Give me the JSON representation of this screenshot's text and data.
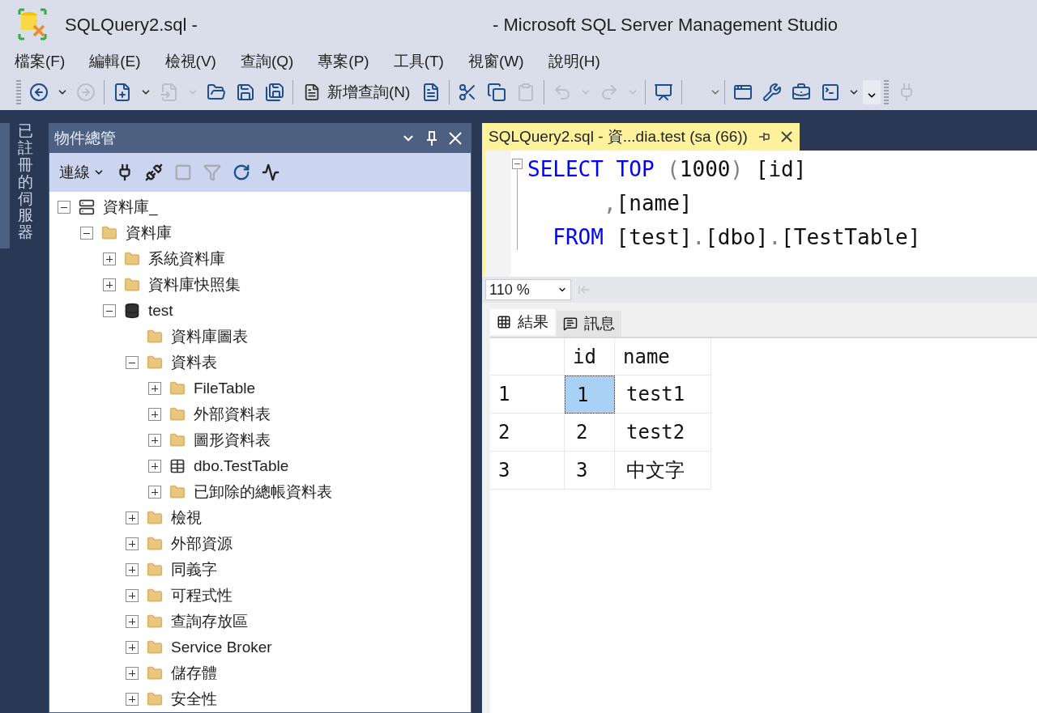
{
  "window": {
    "title_left": "SQLQuery2.sql -",
    "title_right": "- Microsoft SQL Server Management Studio"
  },
  "menu": [
    "檔案(F)",
    "編輯(E)",
    "檢視(V)",
    "查詢(Q)",
    "專案(P)",
    "工具(T)",
    "視窗(W)",
    "說明(H)"
  ],
  "toolbar": [
    {
      "kind": "grip"
    },
    {
      "kind": "icon",
      "disabled": false
    },
    {
      "kind": "caret",
      "disabled": false
    },
    {
      "kind": "icon",
      "disabled": true
    },
    {
      "kind": "sep"
    },
    {
      "kind": "icon",
      "disabled": false
    },
    {
      "kind": "caret",
      "disabled": false
    },
    {
      "kind": "icon",
      "disabled": true
    },
    {
      "kind": "caret",
      "disabled": true
    },
    {
      "kind": "icon",
      "disabled": false
    },
    {
      "kind": "icon",
      "disabled": false
    },
    {
      "kind": "icon",
      "disabled": false
    },
    {
      "kind": "sep"
    },
    {
      "kind": "labeled",
      "label": "新增查詢(N)",
      "disabled": false
    },
    {
      "kind": "icon",
      "disabled": false
    },
    {
      "kind": "sep"
    },
    {
      "kind": "icon",
      "disabled": false
    },
    {
      "kind": "icon",
      "disabled": false
    },
    {
      "kind": "icon",
      "disabled": true
    },
    {
      "kind": "sep"
    },
    {
      "kind": "icon",
      "disabled": true
    },
    {
      "kind": "caret",
      "disabled": true
    },
    {
      "kind": "icon",
      "disabled": true
    },
    {
      "kind": "caret",
      "disabled": true
    },
    {
      "kind": "sep"
    },
    {
      "kind": "icon",
      "disabled": false
    },
    {
      "kind": "sep"
    },
    {
      "kind": "combo",
      "disabled": false
    },
    {
      "kind": "sep"
    },
    {
      "kind": "icon",
      "disabled": false
    },
    {
      "kind": "icon",
      "disabled": false
    },
    {
      "kind": "icon",
      "disabled": false
    },
    {
      "kind": "icon",
      "disabled": false
    },
    {
      "kind": "caret",
      "disabled": false
    },
    {
      "kind": "overflow"
    },
    {
      "kind": "grip"
    },
    {
      "kind": "icon",
      "disabled": true
    }
  ],
  "side_strip": {
    "label": "已註冊的伺服器"
  },
  "object_explorer": {
    "title": "物件總管",
    "connect_label": "連線",
    "tools": [
      {
        "disabled": false
      },
      {
        "disabled": false
      },
      {
        "disabled": true
      },
      {
        "disabled": true
      },
      {
        "disabled": false
      },
      {
        "disabled": false
      }
    ],
    "tree": [
      {
        "label": "資料庫_",
        "kind": "server",
        "expanded": true,
        "children": [
          {
            "label": "資料庫",
            "kind": "folder",
            "expanded": true,
            "children": [
              {
                "label": "系統資料庫",
                "kind": "folder",
                "expanded": false
              },
              {
                "label": "資料庫快照集",
                "kind": "folder",
                "expanded": false
              },
              {
                "label": "test",
                "kind": "database",
                "expanded": true,
                "children": [
                  {
                    "label": "資料庫圖表",
                    "kind": "folder"
                  },
                  {
                    "label": "資料表",
                    "kind": "folder",
                    "expanded": true,
                    "children": [
                      {
                        "label": "FileTable",
                        "kind": "folder",
                        "expanded": false
                      },
                      {
                        "label": "外部資料表",
                        "kind": "folder",
                        "expanded": false
                      },
                      {
                        "label": "圖形資料表",
                        "kind": "folder",
                        "expanded": false
                      },
                      {
                        "label": "dbo.TestTable",
                        "kind": "table",
                        "expanded": false
                      },
                      {
                        "label": "已卸除的總帳資料表",
                        "kind": "folder",
                        "expanded": false
                      }
                    ]
                  },
                  {
                    "label": "檢視",
                    "kind": "folder",
                    "expanded": false
                  },
                  {
                    "label": "外部資源",
                    "kind": "folder",
                    "expanded": false
                  },
                  {
                    "label": "同義字",
                    "kind": "folder",
                    "expanded": false
                  },
                  {
                    "label": "可程式性",
                    "kind": "folder",
                    "expanded": false
                  },
                  {
                    "label": "查詢存放區",
                    "kind": "folder",
                    "expanded": false
                  },
                  {
                    "label": "Service Broker",
                    "kind": "folder",
                    "expanded": false
                  },
                  {
                    "label": "儲存體",
                    "kind": "folder",
                    "expanded": false
                  },
                  {
                    "label": "安全性",
                    "kind": "folder",
                    "expanded": false
                  }
                ]
              }
            ]
          }
        ]
      }
    ]
  },
  "editor": {
    "tab_title": "SQLQuery2.sql - 資...dia.test (sa (66))",
    "lines": [
      [
        {
          "text": "SELECT",
          "kind": "keyword"
        },
        {
          "text": " TOP",
          "kind": "keyword"
        },
        {
          "text": " (",
          "kind": "punct"
        },
        {
          "text": "1000",
          "kind": "plain"
        },
        {
          "text": ")",
          "kind": "punct"
        },
        {
          "text": " [id]",
          "kind": "plain"
        }
      ],
      [
        {
          "text": "      ,",
          "kind": "punct"
        },
        {
          "text": "[name]",
          "kind": "plain"
        }
      ],
      [
        {
          "text": "  FROM",
          "kind": "keyword"
        },
        {
          "text": " [test]",
          "kind": "plain"
        },
        {
          "text": ".",
          "kind": "punct"
        },
        {
          "text": "[dbo]",
          "kind": "plain"
        },
        {
          "text": ".",
          "kind": "punct"
        },
        {
          "text": "[TestTable]",
          "kind": "plain"
        }
      ]
    ],
    "zoom": "110 %"
  },
  "results": {
    "tabs": [
      {
        "label": "結果",
        "selected": true
      },
      {
        "label": "訊息",
        "selected": false
      }
    ],
    "columns": [
      "id",
      "name"
    ],
    "rows": [
      {
        "number": "1",
        "cells": [
          {
            "text": "1",
            "selected": true
          },
          {
            "text": "test1",
            "selected": false
          }
        ]
      },
      {
        "number": "2",
        "cells": [
          {
            "text": "2",
            "selected": false
          },
          {
            "text": "test2",
            "selected": false
          }
        ]
      },
      {
        "number": "3",
        "cells": [
          {
            "text": "3",
            "selected": false
          },
          {
            "text": "中文字",
            "selected": false
          }
        ]
      }
    ]
  }
}
